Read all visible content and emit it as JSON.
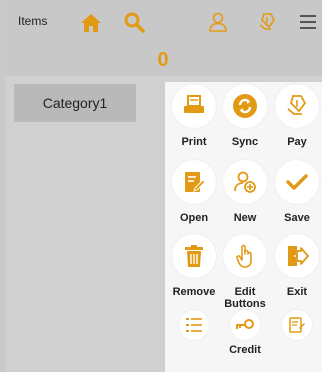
{
  "header": {
    "title": "Items",
    "count": "0"
  },
  "category": {
    "label": "Category1"
  },
  "colors": {
    "accent": "#e29a14"
  },
  "menu": {
    "print": "Print",
    "sync": "Sync",
    "pay": "Pay",
    "open": "Open",
    "new": "New",
    "save": "Save",
    "remove": "Remove",
    "edit_buttons_1": "Edit",
    "edit_buttons_2": "Buttons",
    "exit": "Exit",
    "credit": "Credit"
  }
}
